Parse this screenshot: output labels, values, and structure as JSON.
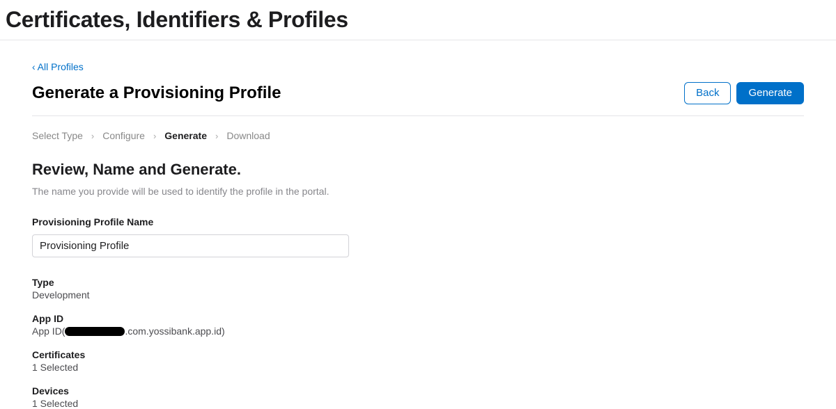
{
  "header": {
    "title": "Certificates, Identifiers & Profiles"
  },
  "back_link": {
    "label": "All Profiles"
  },
  "page_title": "Generate a Provisioning Profile",
  "buttons": {
    "back": "Back",
    "generate": "Generate"
  },
  "breadcrumb": {
    "items": [
      "Select Type",
      "Configure",
      "Generate",
      "Download"
    ],
    "active_index": 2
  },
  "section": {
    "title": "Review, Name and Generate.",
    "description": "The name you provide will be used to identify the profile in the portal."
  },
  "form": {
    "name_label": "Provisioning Profile Name",
    "name_value": "Provisioning Profile"
  },
  "summary": {
    "type": {
      "label": "Type",
      "value": "Development"
    },
    "app_id": {
      "label": "App ID",
      "prefix": "App ID(",
      "suffix": ".com.yossibank.app.id)"
    },
    "certificates": {
      "label": "Certificates",
      "value": "1 Selected"
    },
    "devices": {
      "label": "Devices",
      "value": "1 Selected"
    }
  }
}
